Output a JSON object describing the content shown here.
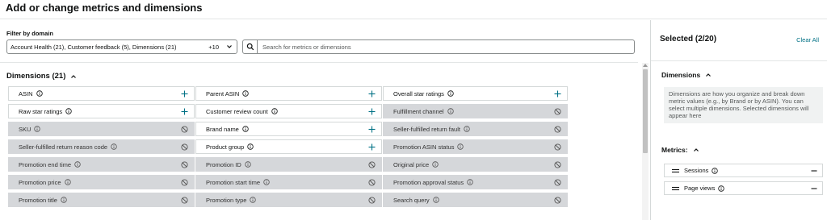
{
  "header": {
    "title": "Add or change metrics and dimensions"
  },
  "filter": {
    "label": "Filter by domain",
    "selected_text": "Account Health (21), Customer feedback (5), Dimensions (21)",
    "more_count": "+10",
    "search_placeholder": "Search for metrics or dimensions"
  },
  "dimensions": {
    "title": "Dimensions (21)",
    "items": [
      {
        "label": "ASIN",
        "enabled": true
      },
      {
        "label": "Parent ASIN",
        "enabled": true
      },
      {
        "label": "Overall star ratings",
        "enabled": true
      },
      {
        "label": "Raw star ratings",
        "enabled": true
      },
      {
        "label": "Customer review count",
        "enabled": true
      },
      {
        "label": "Fulfillment channel",
        "enabled": false
      },
      {
        "label": "SKU",
        "enabled": false
      },
      {
        "label": "Brand name",
        "enabled": true
      },
      {
        "label": "Seller-fulfilled return fault",
        "enabled": false
      },
      {
        "label": "Seller-fulfilled return reason code",
        "enabled": false
      },
      {
        "label": "Product group",
        "enabled": true
      },
      {
        "label": "Promotion ASIN status",
        "enabled": false
      },
      {
        "label": "Promotion end time",
        "enabled": false
      },
      {
        "label": "Promotion ID",
        "enabled": false
      },
      {
        "label": "Original price",
        "enabled": false
      },
      {
        "label": "Promotion price",
        "enabled": false
      },
      {
        "label": "Promotion start time",
        "enabled": false
      },
      {
        "label": "Promotion approval status",
        "enabled": false
      },
      {
        "label": "Promotion title",
        "enabled": false
      },
      {
        "label": "Promotion type",
        "enabled": false
      },
      {
        "label": "Search query",
        "enabled": false
      }
    ]
  },
  "selected": {
    "title": "Selected (2/20)",
    "clear_all": "Clear All",
    "dimensions_title": "Dimensions",
    "dimensions_help": "Dimensions are how you organize and break down metric values (e.g., by Brand or by ASIN). You can select multiple dimensions. Selected dimensions will appear here",
    "metrics_title": "Metrics:",
    "metrics": [
      {
        "label": "Sessions"
      },
      {
        "label": "Page views"
      }
    ]
  },
  "colors": {
    "accent": "#007185",
    "disabled_bg": "#d5d7da",
    "border": "#d5d9d9"
  },
  "icons": {
    "expand": "chevron-up-icon",
    "add": "plus-icon",
    "unavailable": "ban-icon",
    "info": "info-icon",
    "search": "search-icon",
    "grip": "drag-handle-icon",
    "remove": "minus-icon"
  }
}
